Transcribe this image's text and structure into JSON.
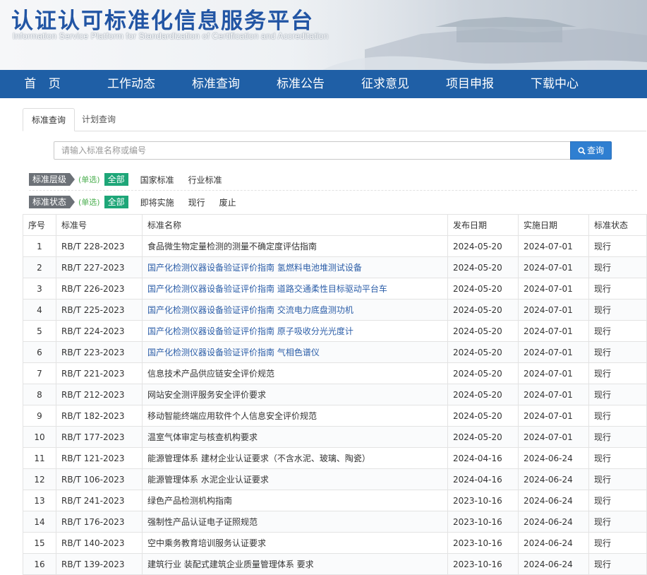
{
  "header": {
    "title": "认证认可标准化信息服务平台",
    "subtitle": "Information Service Platform for Standardization of Certification and Accreditation"
  },
  "nav": [
    "首 页",
    "工作动态",
    "标准查询",
    "标准公告",
    "征求意见",
    "项目申报",
    "下载中心"
  ],
  "tabs": {
    "active": "标准查询",
    "other": "计划查询"
  },
  "search": {
    "placeholder": "请输入标准名称或编号",
    "button": "查询"
  },
  "filters": {
    "level": {
      "label": "标准层级",
      "hint": "(单选)",
      "all": "全部",
      "options": [
        "国家标准",
        "行业标准"
      ]
    },
    "status": {
      "label": "标准状态",
      "hint": "(单选)",
      "all": "全部",
      "options": [
        "即将实施",
        "现行",
        "废止"
      ]
    }
  },
  "table": {
    "headers": [
      "序号",
      "标准号",
      "标准名称",
      "发布日期",
      "实施日期",
      "标准状态"
    ],
    "rows": [
      [
        "1",
        "RB/T 228-2023",
        "食品微生物定量检测的测量不确定度评估指南",
        "2024-05-20",
        "2024-07-01",
        "现行"
      ],
      [
        "2",
        "RB/T 227-2023",
        "国产化检测仪器设备验证评价指南 氢燃料电池堆测试设备",
        "2024-05-20",
        "2024-07-01",
        "现行"
      ],
      [
        "3",
        "RB/T 226-2023",
        "国产化检测仪器设备验证评价指南 道路交通柔性目标驱动平台车",
        "2024-05-20",
        "2024-07-01",
        "现行"
      ],
      [
        "4",
        "RB/T 225-2023",
        "国产化检测仪器设备验证评价指南 交流电力底盘测功机",
        "2024-05-20",
        "2024-07-01",
        "现行"
      ],
      [
        "5",
        "RB/T 224-2023",
        "国产化检测仪器设备验证评价指南 原子吸收分光光度计",
        "2024-05-20",
        "2024-07-01",
        "现行"
      ],
      [
        "6",
        "RB/T 223-2023",
        "国产化检测仪器设备验证评价指南 气相色谱仪",
        "2024-05-20",
        "2024-07-01",
        "现行"
      ],
      [
        "7",
        "RB/T 221-2023",
        "信息技术产品供应链安全评价规范",
        "2024-05-20",
        "2024-07-01",
        "现行"
      ],
      [
        "8",
        "RB/T 212-2023",
        "网站安全测评服务安全评价要求",
        "2024-05-20",
        "2024-07-01",
        "现行"
      ],
      [
        "9",
        "RB/T 182-2023",
        "移动智能终端应用软件个人信息安全评价规范",
        "2024-05-20",
        "2024-07-01",
        "现行"
      ],
      [
        "10",
        "RB/T 177-2023",
        "温室气体审定与核查机构要求",
        "2024-05-20",
        "2024-07-01",
        "现行"
      ],
      [
        "11",
        "RB/T 121-2023",
        "能源管理体系 建材企业认证要求（不含水泥、玻璃、陶瓷）",
        "2024-04-16",
        "2024-06-24",
        "现行"
      ],
      [
        "12",
        "RB/T 106-2023",
        "能源管理体系 水泥企业认证要求",
        "2024-04-16",
        "2024-06-24",
        "现行"
      ],
      [
        "13",
        "RB/T 241-2023",
        "绿色产品检测机构指南",
        "2023-10-16",
        "2024-06-24",
        "现行"
      ],
      [
        "14",
        "RB/T 176-2023",
        "强制性产品认证电子证照规范",
        "2023-10-16",
        "2024-06-24",
        "现行"
      ],
      [
        "15",
        "RB/T 140-2023",
        "空中乘务教育培训服务认证要求",
        "2023-10-16",
        "2024-06-24",
        "现行"
      ],
      [
        "16",
        "RB/T 139-2023",
        "建筑行业 装配式建筑企业质量管理体系 要求",
        "2023-10-16",
        "2024-06-24",
        "现行"
      ]
    ]
  },
  "colors": {
    "nav": "#1f5fa6",
    "title": "#2255a4",
    "button": "#2f7fd1",
    "all_badge": "#1ea678"
  },
  "icons": {
    "search": "search-icon"
  }
}
